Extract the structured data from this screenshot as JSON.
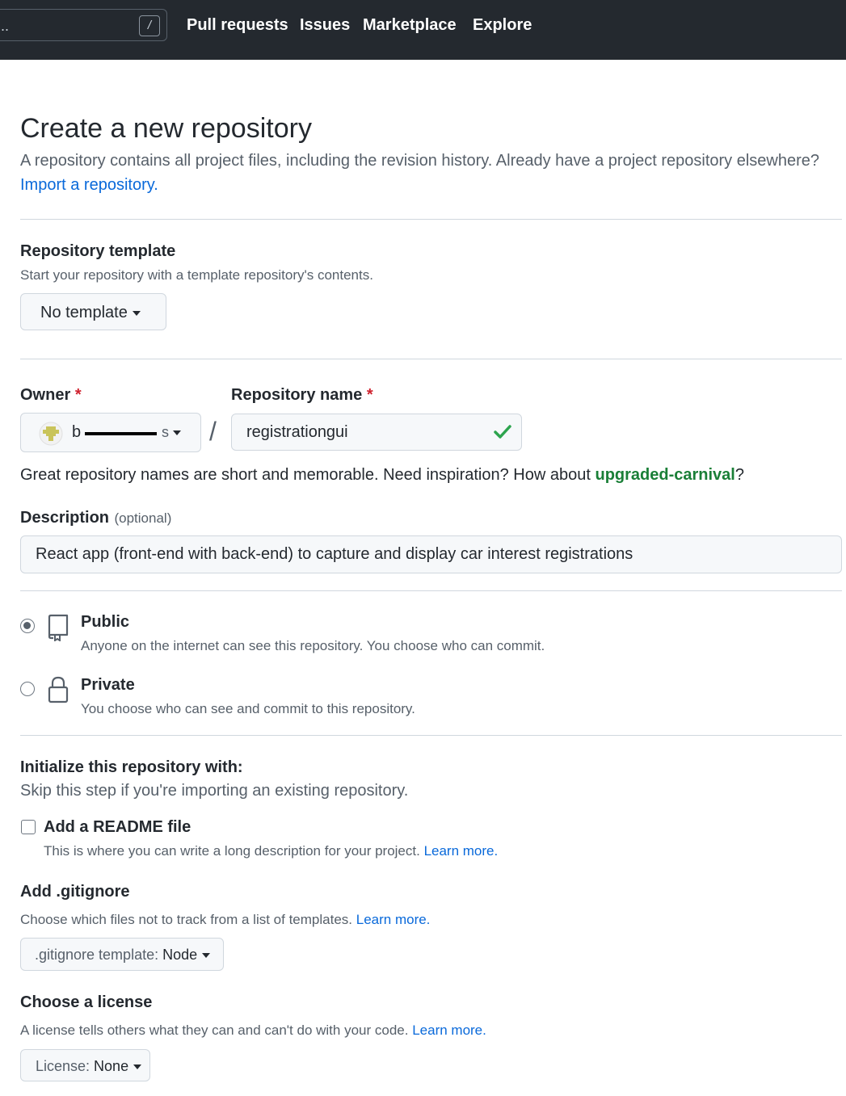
{
  "header": {
    "search_shortcut": "/",
    "search_dots": "..",
    "nav": [
      "Pull requests",
      "Issues",
      "Marketplace",
      "Explore"
    ]
  },
  "page": {
    "title": "Create a new repository",
    "intro": "A repository contains all project files, including the revision history. Already have a project repository elsewhere?",
    "import_link": "Import a repository."
  },
  "template": {
    "label": "Repository template",
    "note": "Start your repository with a template repository's contents.",
    "button": "No template"
  },
  "owner": {
    "label": "Owner",
    "required_mark": "*",
    "value_start": "b",
    "value_end": "s"
  },
  "separator": "/",
  "repo_name": {
    "label": "Repository name",
    "required_mark": "*",
    "value": "registrationgui",
    "hint_prefix": "Great repository names are short and memorable. Need inspiration? How about ",
    "suggestion": "upgraded-carnival",
    "hint_suffix": "?"
  },
  "description": {
    "label": "Description",
    "optional": "(optional)",
    "value": "React app (front-end with back-end) to capture and display car interest registrations"
  },
  "visibility": {
    "public": {
      "label": "Public",
      "note": "Anyone on the internet can see this repository. You choose who can commit.",
      "checked": true
    },
    "private": {
      "label": "Private",
      "note": "You choose who can see and commit to this repository.",
      "checked": false
    }
  },
  "init": {
    "heading": "Initialize this repository with:",
    "note": "Skip this step if you're importing an existing repository.",
    "readme": {
      "label": "Add a README file",
      "note": "This is where you can write a long description for your project.",
      "learn": "Learn more.",
      "checked": false
    }
  },
  "gitignore": {
    "label": "Add .gitignore",
    "note": "Choose which files not to track from a list of templates.",
    "learn": "Learn more.",
    "button_prefix": ".gitignore template: ",
    "button_value": "Node"
  },
  "license": {
    "label": "Choose a license",
    "note": "A license tells others what they can and can't do with your code.",
    "learn": "Learn more.",
    "button_prefix": "License: ",
    "button_value": "None"
  },
  "colors": {
    "header_bg": "#24292f",
    "link": "#0969da",
    "suggestion": "#1a7f37",
    "required": "#cf222e",
    "check_icon": "#2da44e"
  }
}
